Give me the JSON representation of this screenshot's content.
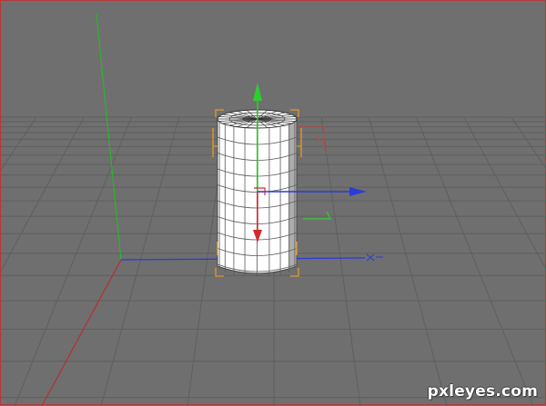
{
  "viewport": {
    "background_color": "#6f6f6f",
    "grid_color": "#5f5f5f",
    "border_color": "#b33a3a"
  },
  "scene": {
    "object": "cylinder",
    "object_color": "#ffffff",
    "wire_color": "#3a3a3a",
    "selection_bracket_color": "#e39a2b",
    "axis_colors": {
      "x": "#2c3bd6",
      "y": "#2bd02b",
      "z": "#d42a2a"
    },
    "icons": {
      "world-axis": "world-axis-icon",
      "move-gizmo": "move-gizmo-icon",
      "x-arrow": "x-axis-arrow-icon",
      "y-arrow": "y-axis-arrow-icon",
      "z-arrow": "z-axis-arrow-icon"
    }
  },
  "watermark": {
    "text": "pxleyes.com",
    "color": "#ffffff"
  }
}
